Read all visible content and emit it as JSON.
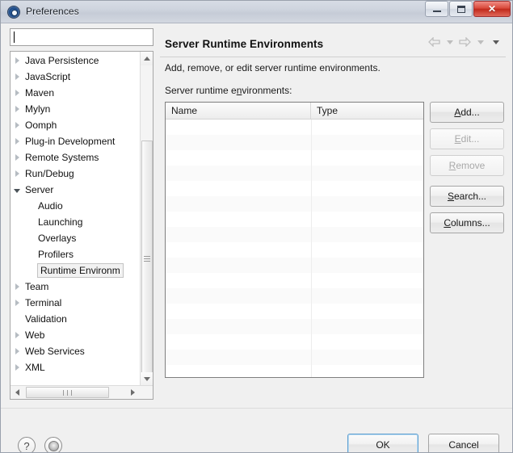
{
  "window": {
    "title": "Preferences",
    "icon": "preferences-gear-icon",
    "controls": {
      "minimize": "minimize-icon",
      "restore": "restore-icon",
      "close": "✕"
    }
  },
  "sidebar": {
    "filter": {
      "value": "",
      "placeholder": ""
    },
    "items": [
      {
        "label": "Java Persistence",
        "state": "collapsed",
        "level": 0
      },
      {
        "label": "JavaScript",
        "state": "collapsed",
        "level": 0
      },
      {
        "label": "Maven",
        "state": "collapsed",
        "level": 0
      },
      {
        "label": "Mylyn",
        "state": "collapsed",
        "level": 0
      },
      {
        "label": "Oomph",
        "state": "collapsed",
        "level": 0
      },
      {
        "label": "Plug-in Development",
        "state": "collapsed",
        "level": 0
      },
      {
        "label": "Remote Systems",
        "state": "collapsed",
        "level": 0
      },
      {
        "label": "Run/Debug",
        "state": "collapsed",
        "level": 0
      },
      {
        "label": "Server",
        "state": "expanded",
        "level": 0
      },
      {
        "label": "Audio",
        "state": "leaf",
        "level": 1
      },
      {
        "label": "Launching",
        "state": "leaf",
        "level": 1
      },
      {
        "label": "Overlays",
        "state": "leaf",
        "level": 1
      },
      {
        "label": "Profilers",
        "state": "leaf",
        "level": 1
      },
      {
        "label": "Runtime Environm",
        "state": "selected",
        "level": 1
      },
      {
        "label": "Team",
        "state": "collapsed",
        "level": 0
      },
      {
        "label": "Terminal",
        "state": "collapsed",
        "level": 0
      },
      {
        "label": "Validation",
        "state": "none",
        "level": 0
      },
      {
        "label": "Web",
        "state": "collapsed",
        "level": 0
      },
      {
        "label": "Web Services",
        "state": "collapsed",
        "level": 0
      },
      {
        "label": "XML",
        "state": "collapsed",
        "level": 0
      }
    ]
  },
  "page": {
    "title": "Server Runtime Environments",
    "description": "Add, remove, or edit server runtime environments.",
    "table_label_pre": "Server runtime e",
    "table_label_mnemonic": "n",
    "table_label_post": "vironments:",
    "nav": {
      "back": "back-arrow-icon",
      "back_menu": "chevron-down-icon",
      "forward": "forward-arrow-icon",
      "forward_menu": "chevron-down-icon",
      "view_menu": "chevron-down-icon"
    }
  },
  "table": {
    "columns": [
      "Name",
      "Type"
    ],
    "rows": []
  },
  "side_buttons": [
    {
      "mnemonic": "A",
      "rest": "dd...",
      "enabled": true,
      "name": "add-button"
    },
    {
      "mnemonic": "E",
      "rest": "dit...",
      "enabled": false,
      "name": "edit-button"
    },
    {
      "mnemonic": "R",
      "rest": "emove",
      "enabled": false,
      "name": "remove-button"
    },
    {
      "mnemonic": "S",
      "rest": "earch...",
      "enabled": true,
      "name": "search-button"
    },
    {
      "mnemonic": "C",
      "rest": "olumns...",
      "enabled": true,
      "name": "columns-button"
    }
  ],
  "footer": {
    "help_icon": "?",
    "secondary_icon": "target-icon",
    "ok": "OK",
    "cancel": "Cancel"
  },
  "annotation": {
    "type": "red-arrow",
    "color": "#ee1b1b",
    "points_to": "add-button"
  }
}
